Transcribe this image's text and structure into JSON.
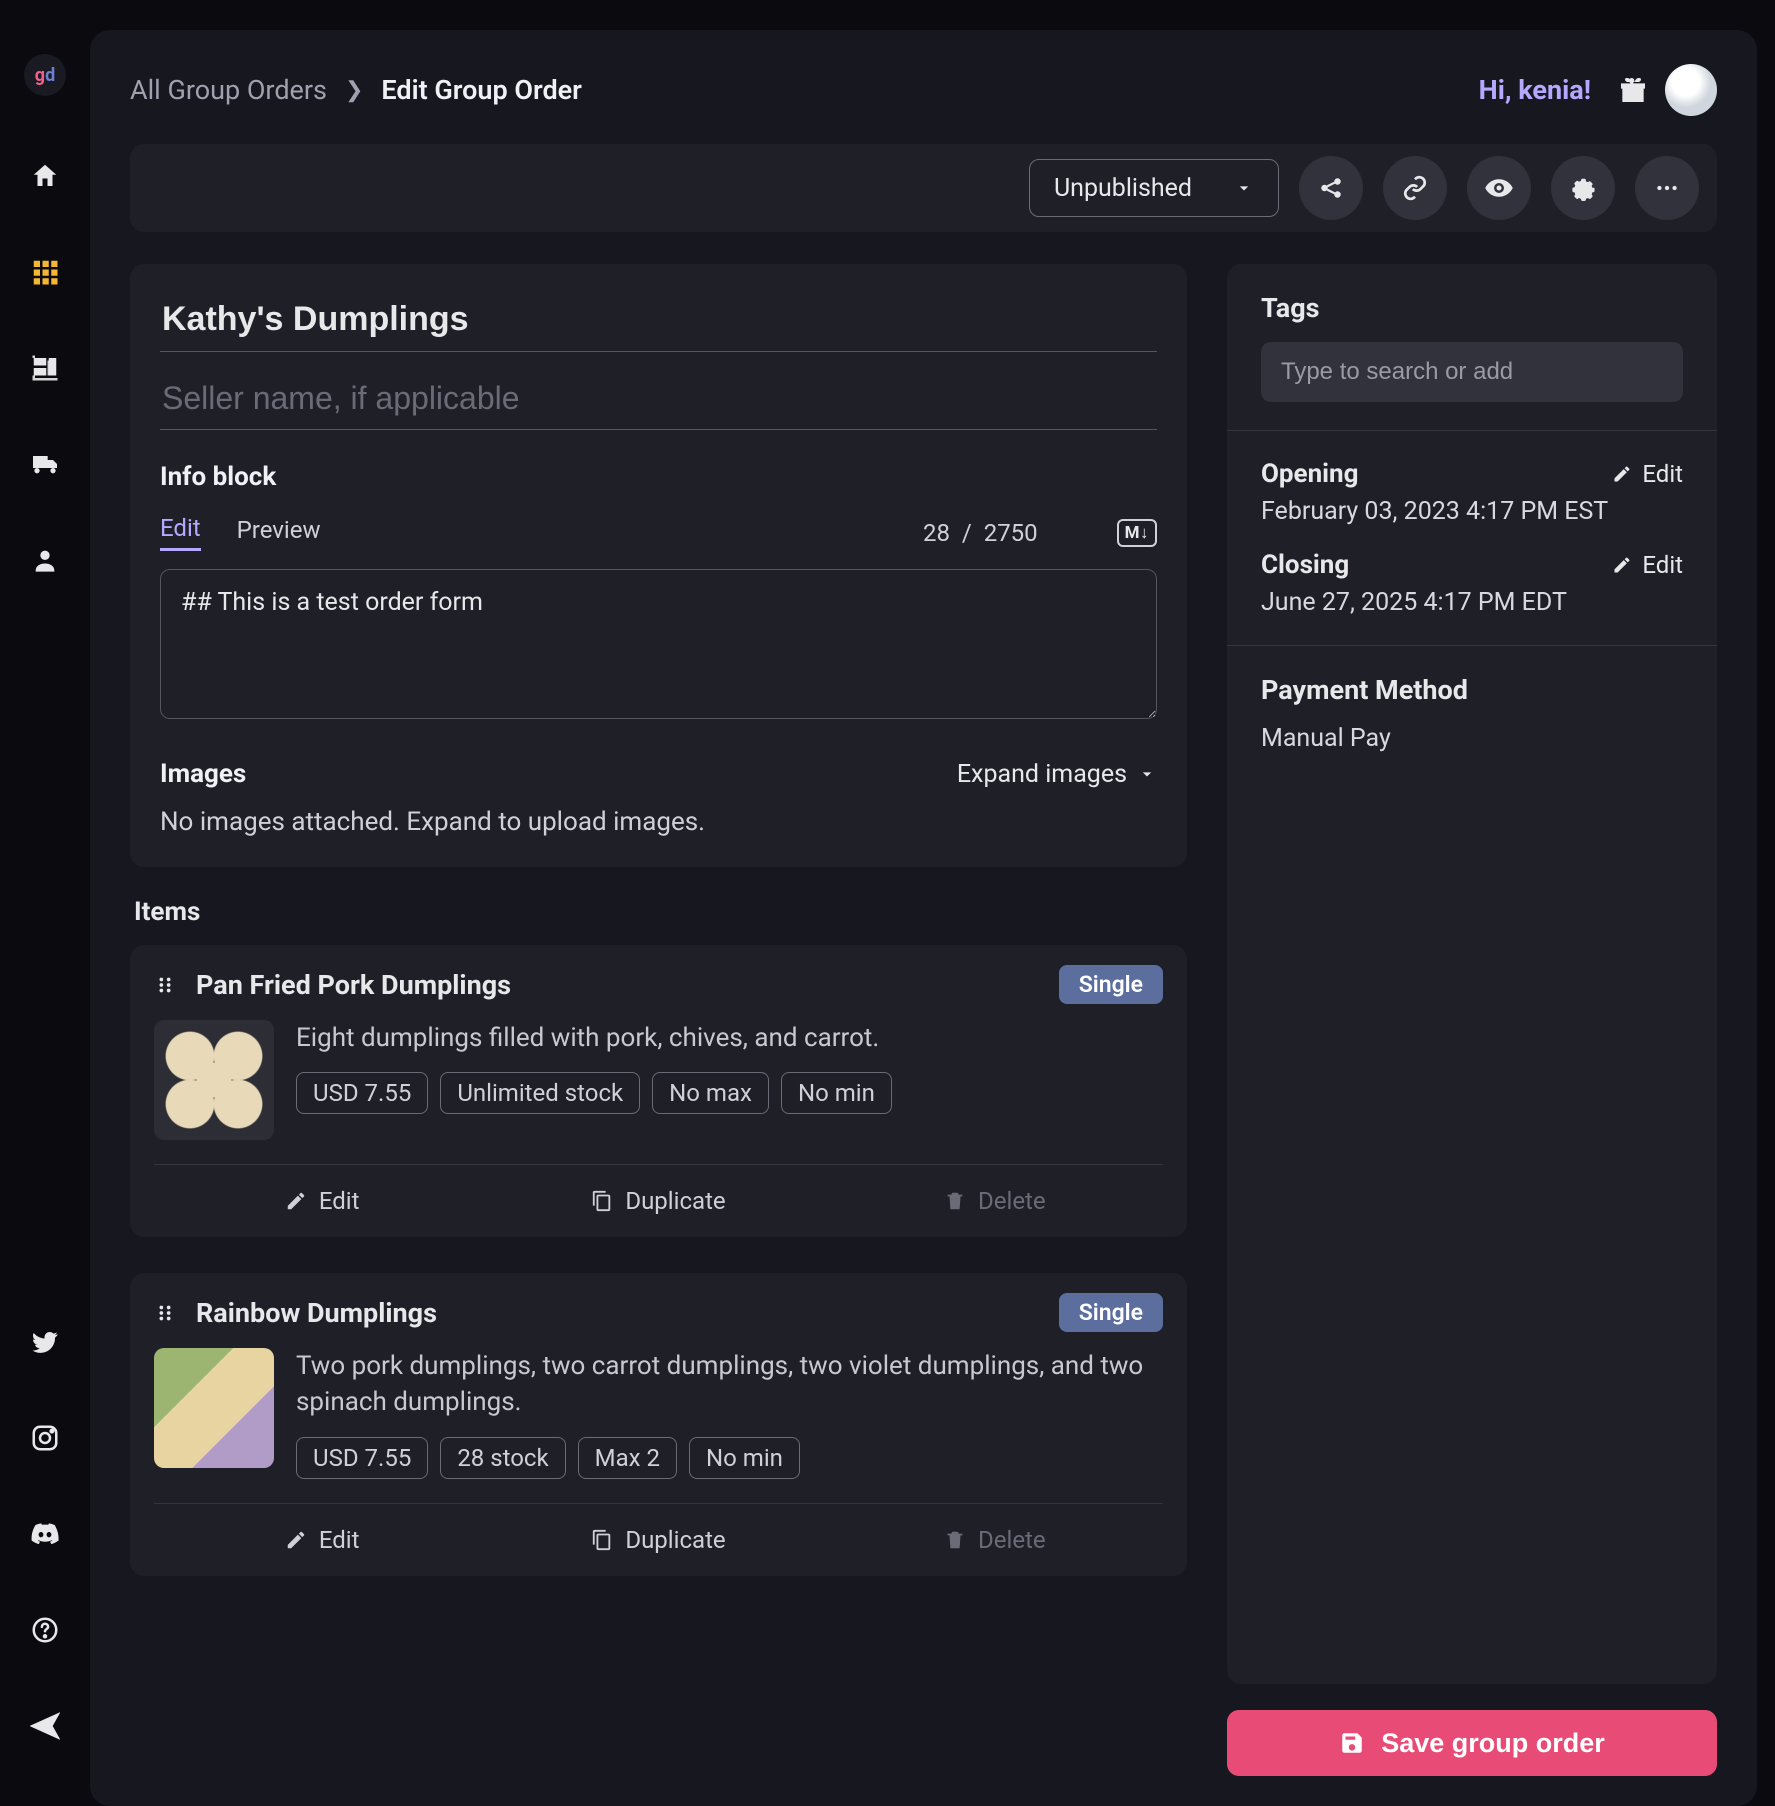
{
  "breadcrumb": {
    "root": "All Group Orders",
    "current": "Edit Group Order"
  },
  "greeting": "Hi, kenia!",
  "toolbar": {
    "status": "Unpublished"
  },
  "form": {
    "title": "Kathy's Dumplings",
    "seller_placeholder": "Seller name, if applicable",
    "info_label": "Info block",
    "tabs": {
      "edit": "Edit",
      "preview": "Preview"
    },
    "char_count": "28",
    "char_limit": "2750",
    "md_badge": "M↓",
    "info_text": "## This is a test order form",
    "images_label": "Images",
    "expand_images": "Expand images",
    "images_empty": "No images attached. Expand to upload images."
  },
  "items_header": "Items",
  "items": [
    {
      "title": "Pan Fried Pork Dumplings",
      "badge": "Single",
      "desc": "Eight dumplings filled with pork, chives, and carrot.",
      "chips": [
        "USD 7.55",
        "Unlimited stock",
        "No max",
        "No min"
      ]
    },
    {
      "title": "Rainbow Dumplings",
      "badge": "Single",
      "desc": "Two pork dumplings, two carrot dumplings, two violet dumplings, and two spinach dumplings.",
      "chips": [
        "USD 7.55",
        "28 stock",
        "Max 2",
        "No min"
      ]
    }
  ],
  "item_actions": {
    "edit": "Edit",
    "duplicate": "Duplicate",
    "delete": "Delete"
  },
  "right": {
    "tags_label": "Tags",
    "tags_placeholder": "Type to search or add",
    "opening_label": "Opening",
    "opening_value": "February 03, 2023 4:17 PM EST",
    "closing_label": "Closing",
    "closing_value": "June 27, 2025 4:17 PM EDT",
    "edit": "Edit",
    "pm_label": "Payment Method",
    "pm_value": "Manual Pay"
  },
  "save_label": "Save group order"
}
